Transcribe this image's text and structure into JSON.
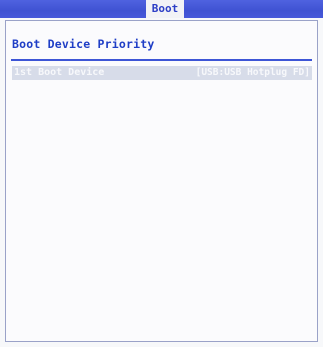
{
  "menu": {
    "active_tab": "Boot"
  },
  "panel": {
    "title": "Boot Device Priority",
    "items": [
      {
        "label": "1st Boot Device",
        "value": "[USB:USB Hotplug FD]"
      }
    ]
  },
  "colors": {
    "accent": "#3f52d2",
    "title_text": "#1f3ec6",
    "selected_row": "#d7dce9",
    "background": "#f7f8fa"
  }
}
